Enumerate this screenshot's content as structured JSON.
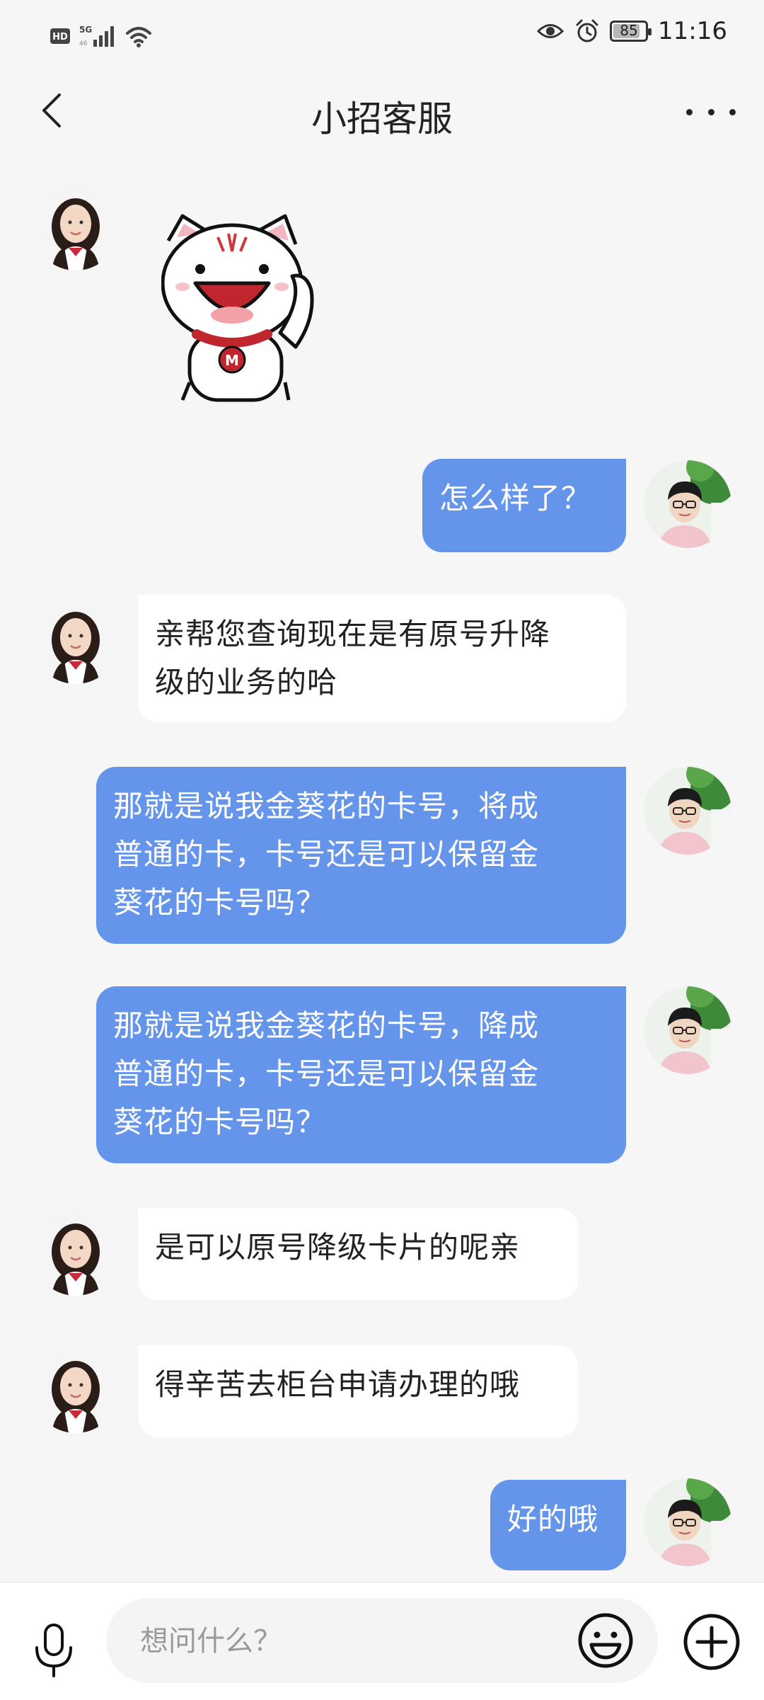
{
  "status_bar": {
    "hd_label": "HD",
    "network": "5G",
    "network_sub": "46",
    "battery": "85",
    "battery_level_percent": 85,
    "time": "11:16"
  },
  "header": {
    "title": "小招客服"
  },
  "messages": [
    {
      "from": "agent",
      "type": "sticker",
      "sticker_text": "M"
    },
    {
      "from": "user",
      "type": "text",
      "text": "怎么样了？"
    },
    {
      "from": "agent",
      "type": "text",
      "lines": [
        "亲帮您查询现在是有原号升降",
        "级的业务的哈"
      ]
    },
    {
      "from": "user",
      "type": "text",
      "lines": [
        "那就是说我金葵花的卡号，将成",
        "普通的卡，卡号还是可以保留金",
        "葵花的卡号吗？"
      ]
    },
    {
      "from": "user",
      "type": "text",
      "lines": [
        "那就是说我金葵花的卡号，降成",
        "普通的卡，卡号还是可以保留金",
        "葵花的卡号吗？"
      ]
    },
    {
      "from": "agent",
      "type": "text",
      "text": "是可以原号降级卡片的呢亲"
    },
    {
      "from": "agent",
      "type": "text",
      "text": "得辛苦去柜台申请办理的哦"
    },
    {
      "from": "user",
      "type": "text",
      "text": "好的哦"
    }
  ],
  "composer": {
    "placeholder": "想问什么？"
  },
  "colors": {
    "out_bubble": "#6495ea",
    "in_bubble": "#ffffff",
    "background": "#f6f6f6"
  },
  "icons": [
    "back-arrow-icon",
    "more-icon",
    "microphone-icon",
    "emoji-icon",
    "plus-icon",
    "eye-icon",
    "alarm-icon",
    "wifi-icon",
    "signal-icon"
  ]
}
